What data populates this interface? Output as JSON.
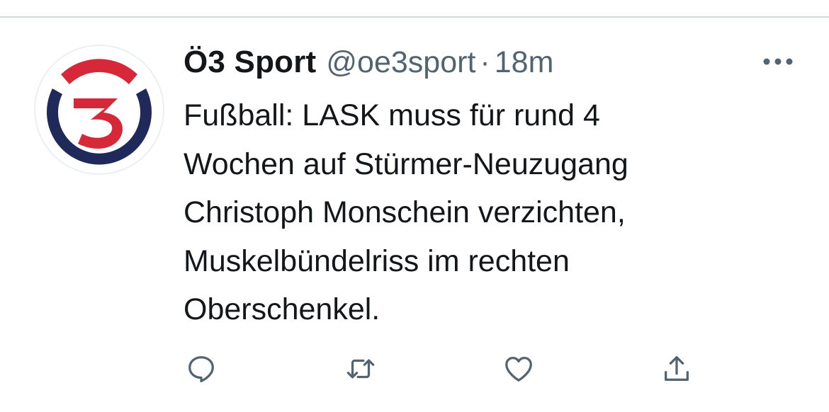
{
  "tweet": {
    "display_name": "Ö3 Sport",
    "handle": "@oe3sport",
    "separator": "·",
    "timestamp": "18m",
    "text_lines": [
      "Fußball: LASK muss für rund 4",
      "Wochen auf Stürmer-Neuzugang",
      "Christoph Monschein verzichten,",
      "Muskelbündelriss im rechten",
      "Oberschenkel."
    ]
  },
  "avatar": {
    "icon": "oe3-logo",
    "colors": {
      "red": "#d62839",
      "navy": "#1f2a5a"
    }
  },
  "actions": [
    {
      "icon": "reply-icon"
    },
    {
      "icon": "retweet-icon"
    },
    {
      "icon": "like-icon"
    },
    {
      "icon": "share-icon"
    }
  ],
  "colors": {
    "primary_text": "#14171a",
    "secondary_text": "#536471",
    "icon": "#536471",
    "divider": "#cfd9de"
  }
}
